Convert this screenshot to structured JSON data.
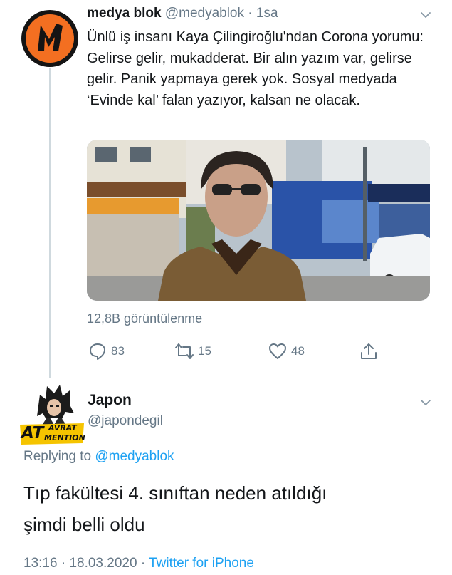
{
  "tweet1": {
    "name": "medya blok",
    "handle": "@medyablok",
    "separator": "·",
    "time": "1sa",
    "text": "Ünlü iş insanı Kaya Çilingiroğlu'ndan Corona yorumu:  Gelirse gelir, mukadderat. Bir alın yazım var, gelirse gelir. Panik yapmaya gerek yok. Sosyal medyada ‘Evinde kal’ falan yazıyor, kalsan ne olacak.",
    "views": "12,8B görüntülenme",
    "reply_count": "83",
    "retweet_count": "15",
    "like_count": "48"
  },
  "tweet2": {
    "name": "Japon",
    "handle": "@japondegil",
    "avatar_badge_top": "AVRAT",
    "avatar_badge_left": "AT",
    "avatar_badge_bottom": "MENTION",
    "replying_prefix": "Replying to",
    "replying_to": "@medyablok",
    "text_line1": "Tıp fakültesi 4. sınıftan neden atıldığı",
    "text_line2": "şimdi belli oldu",
    "time": "13:16",
    "separator": "·",
    "date": "18.03.2020",
    "client": "Twitter for iPhone"
  },
  "colors": {
    "link": "#1da1f2",
    "muted": "#657786",
    "brand_orange": "#f36f21"
  }
}
